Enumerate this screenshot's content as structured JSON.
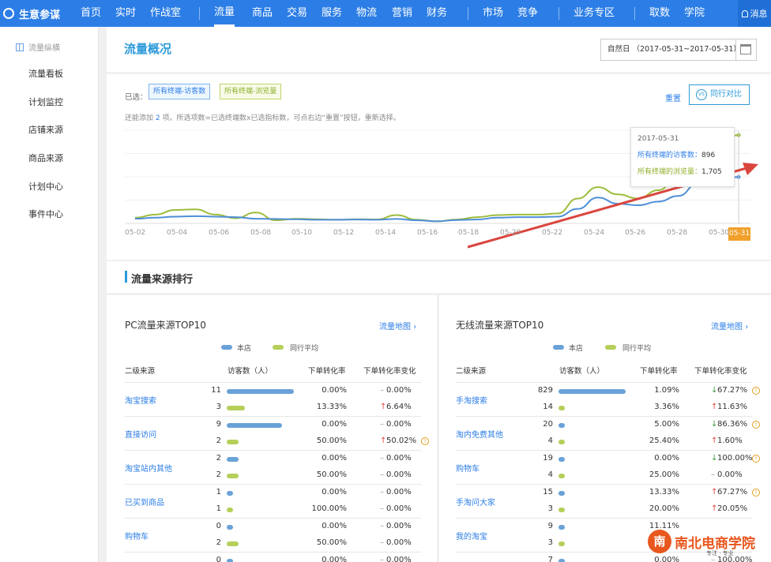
{
  "brand": "生意参谋",
  "nav": {
    "items": [
      {
        "label": "首页"
      },
      {
        "label": "实时"
      },
      {
        "label": "作战室"
      },
      {
        "label": "流量",
        "active": true
      },
      {
        "label": "商品"
      },
      {
        "label": "交易"
      },
      {
        "label": "服务"
      },
      {
        "label": "物流"
      },
      {
        "label": "营销"
      },
      {
        "label": "财务"
      },
      {
        "label": "市场"
      },
      {
        "label": "竞争"
      },
      {
        "label": "业务专区"
      },
      {
        "label": "取数"
      },
      {
        "label": "学院"
      }
    ],
    "message": "消息"
  },
  "sidebar": {
    "header": "流量纵横",
    "items": [
      "流量看板",
      "计划监控",
      "店铺来源",
      "商品来源",
      "计划中心",
      "事件中心"
    ]
  },
  "overview": {
    "title": "流量概况",
    "date_range": "自然日 （2017-05-31~2017-05-31）",
    "selected_label": "已选：",
    "chips": [
      "所有终端-访客数",
      "所有终端-浏览量"
    ],
    "hint_prefix": "还能添加",
    "hint_count": "2",
    "hint_suffix": "项。所选项数=已选终端数x已选指标数，可点右边“重置”按钮，重新选择。",
    "reset": "重置",
    "compare": "同行对比",
    "compare_icon": "VS"
  },
  "tooltip": {
    "date": "2017-05-31",
    "rows": [
      {
        "label": "所有终端的访客数：",
        "value": "896"
      },
      {
        "label": "所有终端的浏览量：",
        "value": "1,705"
      }
    ]
  },
  "chart_data": {
    "type": "line",
    "x": [
      "05-01",
      "05-02",
      "05-03",
      "05-04",
      "05-05",
      "05-06",
      "05-07",
      "05-08",
      "05-09",
      "05-10",
      "05-11",
      "05-12",
      "05-13",
      "05-14",
      "05-15",
      "05-16",
      "05-17",
      "05-18",
      "05-19",
      "05-20",
      "05-21",
      "05-22",
      "05-23",
      "05-24",
      "05-25",
      "05-26",
      "05-27",
      "05-28",
      "05-29",
      "05-30",
      "05-31"
    ],
    "x_ticks": [
      "05-02",
      "05-04",
      "05-06",
      "05-08",
      "05-10",
      "05-12",
      "05-14",
      "05-16",
      "05-18",
      "05-20",
      "05-22",
      "05-24",
      "05-26",
      "05-28",
      "05-30",
      "05-31"
    ],
    "series": [
      {
        "name": "所有终端的访客数",
        "color": "#4f8fd6",
        "values": [
          90,
          110,
          130,
          140,
          130,
          120,
          90,
          85,
          80,
          70,
          70,
          75,
          70,
          85,
          60,
          40,
          65,
          75,
          110,
          120,
          120,
          130,
          280,
          500,
          380,
          350,
          420,
          530,
          780,
          870,
          896
        ]
      },
      {
        "name": "所有终端的浏览量",
        "color": "#9dbd3c",
        "values": [
          110,
          170,
          260,
          270,
          170,
          100,
          210,
          60,
          90,
          80,
          70,
          80,
          75,
          160,
          70,
          40,
          75,
          120,
          160,
          170,
          170,
          190,
          480,
          700,
          560,
          480,
          640,
          900,
          1300,
          1600,
          1705
        ]
      }
    ],
    "ylim": [
      0,
      1800
    ],
    "grid": true
  },
  "ranking": {
    "title": "流量来源排行",
    "legend_own": "本店",
    "legend_peer": "同行平均",
    "headers": [
      "二级来源",
      "访客数（人）",
      "下单转化率",
      "下单转化率变化"
    ],
    "pc": {
      "title": "PC流量来源TOP10",
      "link": "流量地图",
      "max": 11,
      "rows": [
        {
          "name": "淘宝搜索",
          "own": {
            "visitors": 11,
            "rate": "0.00%",
            "change": "0.00%",
            "dir": "flat"
          },
          "peer": {
            "visitors": 3,
            "rate": "13.33%",
            "change": "6.64%",
            "dir": "up"
          }
        },
        {
          "name": "直接访问",
          "own": {
            "visitors": 9,
            "rate": "0.00%",
            "change": "0.00%",
            "dir": "flat"
          },
          "peer": {
            "visitors": 2,
            "rate": "50.00%",
            "change": "50.02%",
            "dir": "up",
            "warn": true
          }
        },
        {
          "name": "淘宝站内其他",
          "own": {
            "visitors": 2,
            "rate": "0.00%",
            "change": "0.00%",
            "dir": "flat"
          },
          "peer": {
            "visitors": 2,
            "rate": "50.00%",
            "change": "0.00%",
            "dir": "flat"
          }
        },
        {
          "name": "已买到商品",
          "own": {
            "visitors": 1,
            "rate": "0.00%",
            "change": "0.00%",
            "dir": "flat"
          },
          "peer": {
            "visitors": 1,
            "rate": "100.00%",
            "change": "0.00%",
            "dir": "flat"
          }
        },
        {
          "name": "购物车",
          "own": {
            "visitors": 0,
            "rate": "0.00%",
            "change": "0.00%",
            "dir": "flat"
          },
          "peer": {
            "visitors": 2,
            "rate": "50.00%",
            "change": "0.00%",
            "dir": "flat"
          }
        }
      ],
      "partial_row": {
        "visitors": 0,
        "rate": "0.00%",
        "change": "0.00%"
      }
    },
    "mobile": {
      "title": "无线流量来源TOP10",
      "link": "流量地图",
      "max": 829,
      "rows": [
        {
          "name": "手淘搜索",
          "own": {
            "visitors": 829,
            "rate": "1.09%",
            "change": "67.27%",
            "dir": "down",
            "warn": true
          },
          "peer": {
            "visitors": 14,
            "rate": "3.36%",
            "change": "11.63%",
            "dir": "up"
          }
        },
        {
          "name": "淘内免费其他",
          "own": {
            "visitors": 20,
            "rate": "5.00%",
            "change": "86.36%",
            "dir": "down",
            "warn": true
          },
          "peer": {
            "visitors": 4,
            "rate": "25.40%",
            "change": "1.60%",
            "dir": "up"
          }
        },
        {
          "name": "购物车",
          "own": {
            "visitors": 19,
            "rate": "0.00%",
            "change": "100.00%",
            "dir": "down",
            "warn": true
          },
          "peer": {
            "visitors": 4,
            "rate": "25.00%",
            "change": "0.00%",
            "dir": "flat"
          }
        },
        {
          "name": "手淘问大家",
          "own": {
            "visitors": 15,
            "rate": "13.33%",
            "change": "67.27%",
            "dir": "up",
            "warn": true
          },
          "peer": {
            "visitors": 3,
            "rate": "20.00%",
            "change": "20.05%",
            "dir": "up"
          }
        },
        {
          "name": "我的淘宝",
          "own": {
            "visitors": 9,
            "rate": "11.11%",
            "change": "",
            "dir": "flat"
          },
          "peer": {
            "visitors": 3,
            "rate": "",
            "change": "",
            "dir": "flat"
          }
        }
      ],
      "partial_row": {
        "visitors": 7,
        "rate": "0.00%",
        "change": "100.00%"
      }
    }
  },
  "watermark": {
    "logo": "南",
    "text": "南北电商学院",
    "sub": "专注 · 专业"
  }
}
